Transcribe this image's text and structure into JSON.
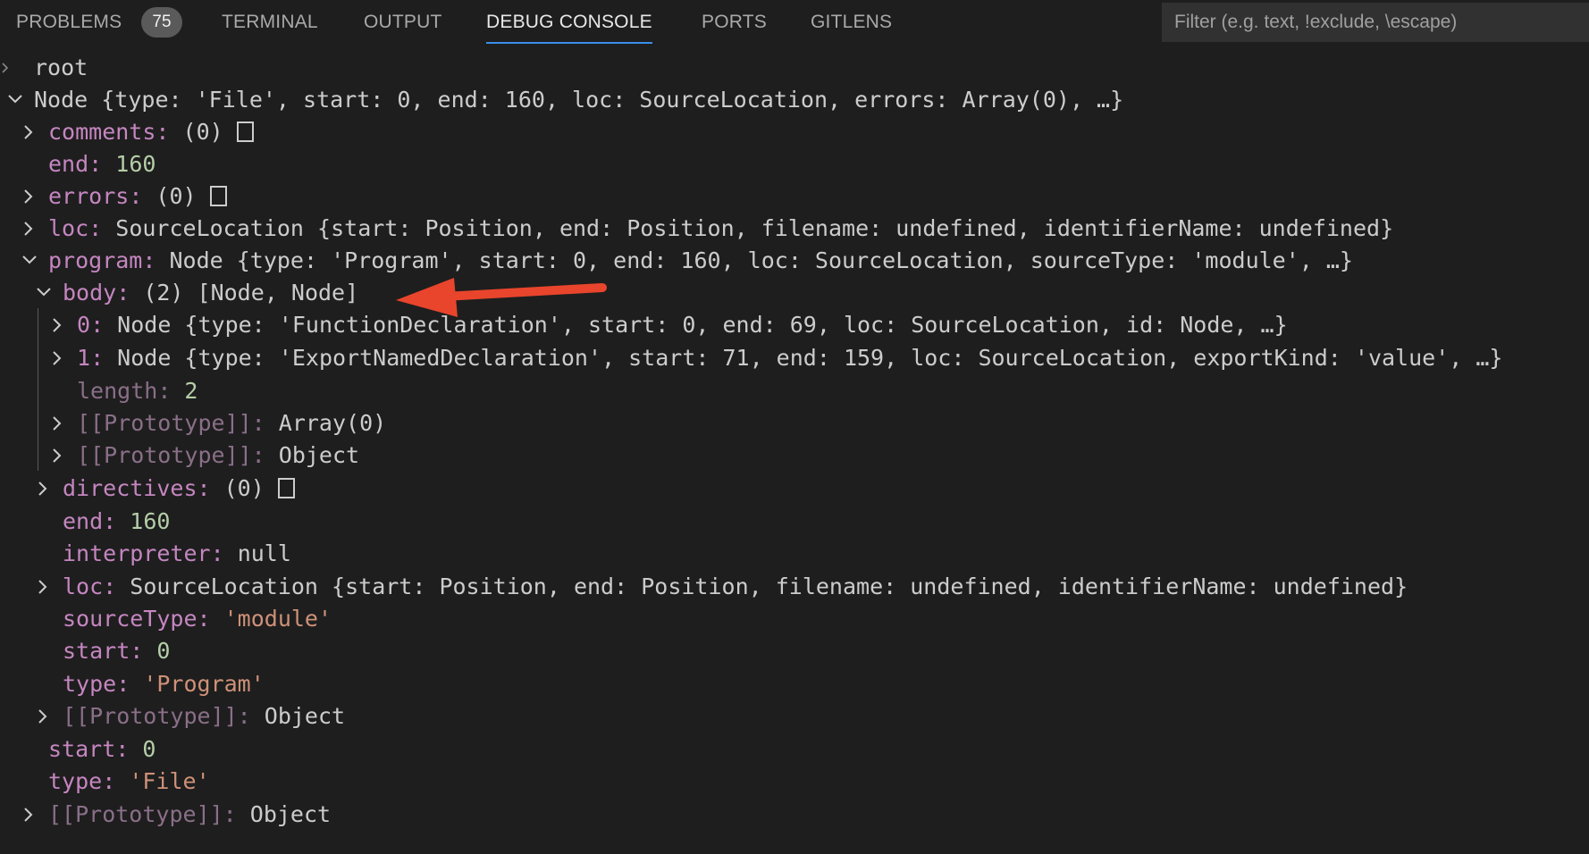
{
  "tabs": {
    "problems": "PROBLEMS",
    "problems_count": "75",
    "terminal": "TERMINAL",
    "output": "OUTPUT",
    "debug_console": "DEBUG CONSOLE",
    "ports": "PORTS",
    "gitlens": "GITLENS"
  },
  "filter": {
    "placeholder": "Filter (e.g. text, !exclude, \\escape)"
  },
  "tree": {
    "root": "root",
    "node_summary": "Node {type: 'File', start: 0, end: 160, loc: SourceLocation, errors: Array(0), …}",
    "comments_key": "comments",
    "comments_val": "(0)",
    "end_key": "end",
    "end_val": "160",
    "errors_key": "errors",
    "errors_val": "(0)",
    "loc_key": "loc",
    "loc_val": "SourceLocation {start: Position, end: Position, filename: undefined, identifierName: undefined}",
    "program_key": "program",
    "program_val": "Node {type: 'Program', start: 0, end: 160, loc: SourceLocation, sourceType: 'module', …}",
    "body_key": "body",
    "body_val": "(2) [Node, Node]",
    "item0_key": "0",
    "item0_val": "Node {type: 'FunctionDeclaration', start: 0, end: 69, loc: SourceLocation, id: Node, …}",
    "item1_key": "1",
    "item1_val": "Node {type: 'ExportNamedDeclaration', start: 71, end: 159, loc: SourceLocation, exportKind: 'value', …}",
    "length_key": "length",
    "length_val": "2",
    "proto_key": "[[Prototype]]",
    "proto_array_val": "Array(0)",
    "proto_object_val": "Object",
    "directives_key": "directives",
    "directives_val": "(0)",
    "p_end_val": "160",
    "interpreter_key": "interpreter",
    "interpreter_val": "null",
    "p_loc_val": "SourceLocation {start: Position, end: Position, filename: undefined, identifierName: undefined}",
    "sourceType_key": "sourceType",
    "sourceType_val": "'module'",
    "start_key": "start",
    "start_val": "0",
    "type_key": "type",
    "p_type_val": "'Program'",
    "f_type_val": "'File'"
  },
  "colors": {
    "background": "#1e1e1e",
    "key": "#c586c0",
    "number": "#b5cea8",
    "string": "#ce9178",
    "accent": "#3b8eea",
    "annotation_arrow": "#e8452c"
  }
}
